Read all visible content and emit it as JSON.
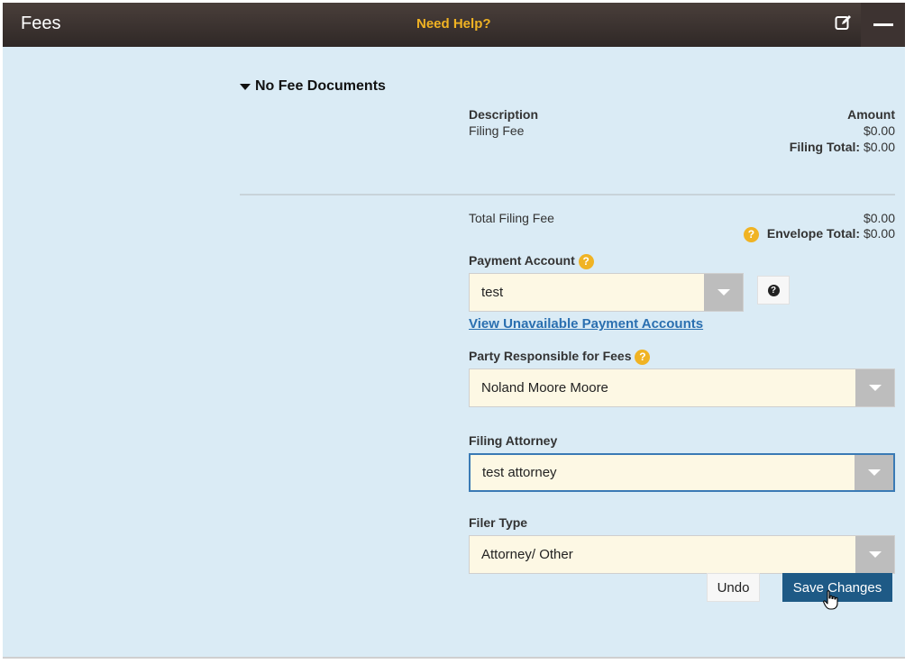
{
  "header": {
    "title": "Fees",
    "help_link": "Need Help?",
    "edit_icon": "edit-icon",
    "collapse_icon": "minus-icon"
  },
  "section": {
    "toggle_label": "No Fee Documents",
    "description_header": "Description",
    "amount_header": "Amount",
    "fee_item": {
      "description": "Filing Fee",
      "amount": "$0.00"
    },
    "filing_total_label": "Filing Total:",
    "filing_total_value": "$0.00"
  },
  "totals": {
    "total_filing_fee_label": "Total Filing Fee",
    "total_filing_fee_value": "$0.00",
    "envelope_total_label": "Envelope Total:",
    "envelope_total_value": "$0.00"
  },
  "payment_account": {
    "label": "Payment Account",
    "value": "test",
    "link": "View Unavailable Payment Accounts"
  },
  "party_responsible": {
    "label": "Party Responsible for Fees",
    "value": "Noland Moore Moore"
  },
  "filing_attorney": {
    "label": "Filing Attorney",
    "value": "test attorney"
  },
  "filer_type": {
    "label": "Filer Type",
    "value": "Attorney/ Other"
  },
  "actions": {
    "undo": "Undo",
    "save": "Save Changes"
  },
  "colors": {
    "header_bg": "#2f2826",
    "panel_bg": "#daebf5",
    "help_accent": "#f0b323",
    "link": "#2a6fb0",
    "save_button": "#1e5a86",
    "select_bg": "#fdf8e4"
  }
}
